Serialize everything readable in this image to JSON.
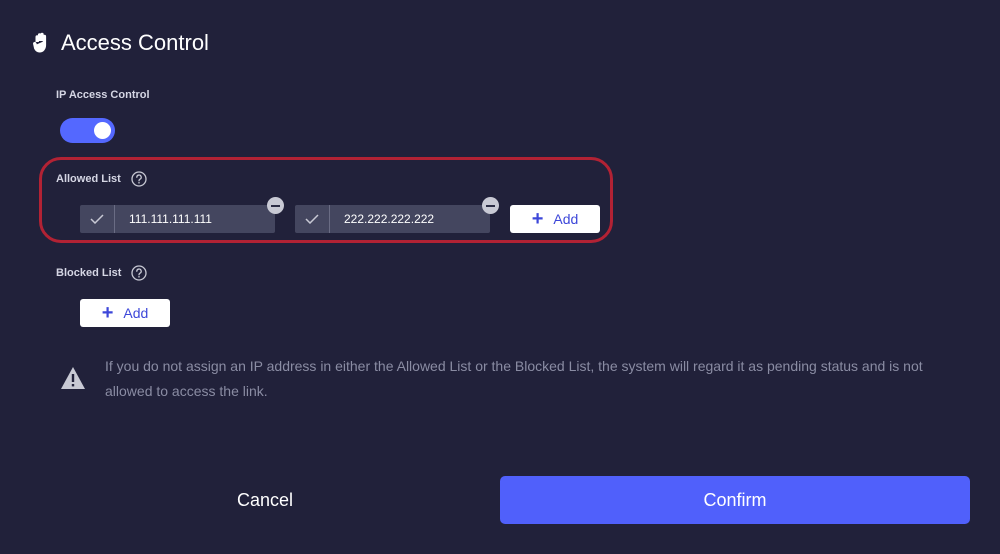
{
  "header": {
    "title": "Access Control",
    "icon": "hand-icon"
  },
  "ip_access": {
    "label": "IP Access Control",
    "enabled": true
  },
  "allowed": {
    "label": "Allowed List",
    "entries": [
      "111.111.111.111",
      "222.222.222.222"
    ],
    "add_label": "Add"
  },
  "blocked": {
    "label": "Blocked List",
    "add_label": "Add"
  },
  "notice": {
    "icon": "warning-icon",
    "text": "If you do not assign an IP address in either the Allowed List or the Blocked List, the system will regard it as pending status and is not allowed to access the link."
  },
  "footer": {
    "cancel_label": "Cancel",
    "confirm_label": "Confirm"
  },
  "colors": {
    "background": "#21213a",
    "accent": "#5060fb",
    "highlight": "#b22234"
  }
}
